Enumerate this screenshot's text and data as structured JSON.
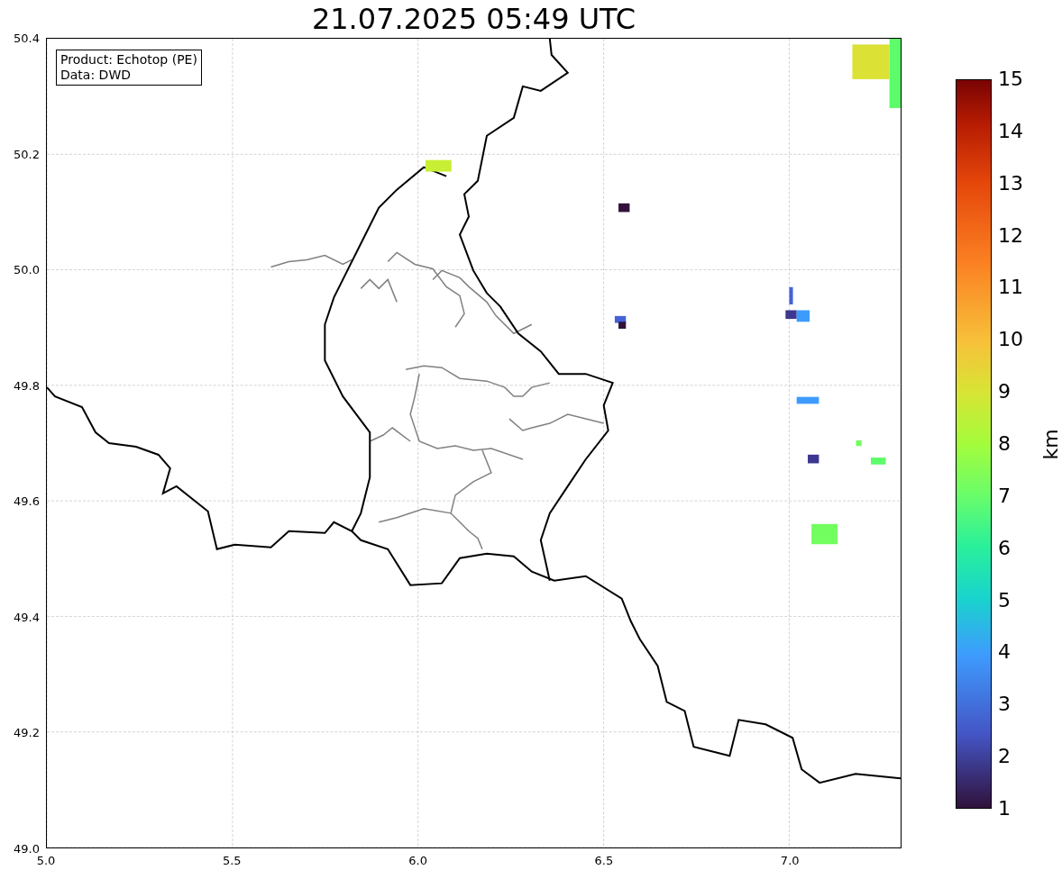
{
  "title": "21.07.2025 05:49 UTC",
  "legend": [
    "Product: Echotop (PE)",
    "Data: DWD"
  ],
  "x_ticks": [
    "5.0",
    "5.5",
    "6.0",
    "6.5",
    "7.0"
  ],
  "y_ticks": [
    "50.4",
    "50.2",
    "50.0",
    "49.8",
    "49.6",
    "49.4",
    "49.2",
    "49.0"
  ],
  "colorbar": {
    "label": "km",
    "ticks": [
      "15",
      "14",
      "13",
      "12",
      "11",
      "10",
      "9",
      "8",
      "7",
      "6",
      "5",
      "4",
      "3",
      "2",
      "1"
    ]
  }
}
